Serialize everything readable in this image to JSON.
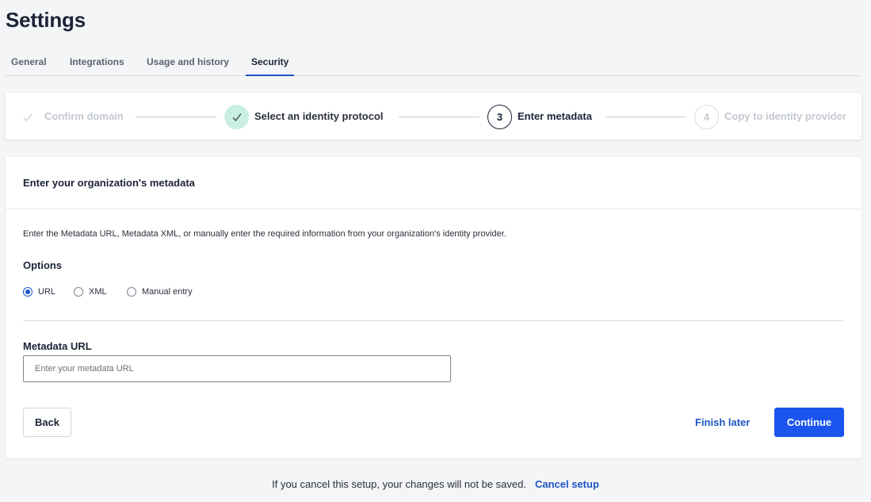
{
  "page": {
    "title": "Settings"
  },
  "tabs": [
    {
      "label": "General"
    },
    {
      "label": "Integrations"
    },
    {
      "label": "Usage and history"
    },
    {
      "label": "Security",
      "active": true
    }
  ],
  "stepper": {
    "steps": [
      {
        "label": "Confirm domain",
        "state": "done-faded",
        "icon": "check-icon"
      },
      {
        "label": "Select an identity protocol",
        "state": "completed",
        "icon": "check-icon"
      },
      {
        "number": "3",
        "label": "Enter metadata",
        "state": "current"
      },
      {
        "number": "4",
        "label": "Copy to identity provider",
        "state": "upcoming"
      }
    ]
  },
  "card": {
    "title": "Enter your organization's metadata",
    "description": "Enter the Metadata URL, Metadata XML, or manually enter the required information from your organization's identity provider.",
    "options_label": "Options",
    "options": [
      {
        "label": "URL",
        "checked": true
      },
      {
        "label": "XML",
        "checked": false
      },
      {
        "label": "Manual entry",
        "checked": false
      }
    ],
    "field": {
      "label": "Metadata URL",
      "value": "",
      "placeholder": "Enter your metadata URL"
    },
    "back_label": "Back",
    "finish_later_label": "Finish later",
    "continue_label": "Continue"
  },
  "footer": {
    "text": "If you cancel this setup, your changes will not be saved.",
    "link": "Cancel setup"
  },
  "colors": {
    "accent": "#1b55c4",
    "primary_button": "#1b55ee",
    "completed_step": "#c9efe0",
    "faded_text": "#c4c9d0"
  }
}
